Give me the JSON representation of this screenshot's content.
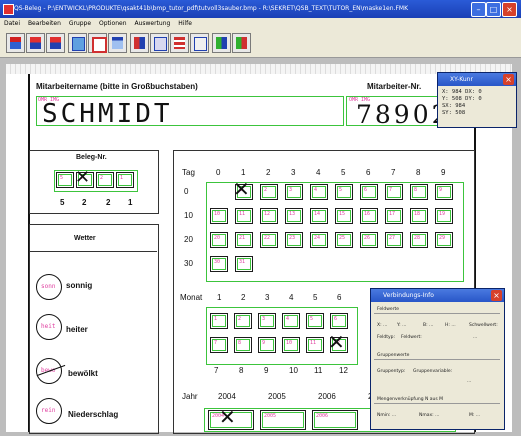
{
  "window": {
    "title": "QS-Beleg - P:\\ENTWICKL\\PRODUKTE\\qsakt41b\\bmp_tutor_pdf\\tutvoll3sauber.bmp - R:\\SEKRET\\QSB_TEXT\\TUTOR_EN\\maske1en.FMK"
  },
  "menu": [
    "Datei",
    "Bearbeiten",
    "Gruppe",
    "Optionen",
    "Auswertung",
    "Hilfe"
  ],
  "form": {
    "name_label": "Mitarbeitername (bitte in Großbuchstaben)",
    "nr_label": "Mitarbeiter-Nr.",
    "field_tag_1": "OMR IMG",
    "field_tag_2": "OMR IMG",
    "name_value": "SCHMIDT",
    "nr_value": "78902",
    "beleg_label": "Beleg-Nr.",
    "beleg_digits": [
      "5",
      "2",
      "2",
      "1"
    ],
    "beleg_cells": [
      "5",
      "2",
      "2",
      "1"
    ],
    "wetter_label": "Wetter",
    "weather": [
      {
        "tag": "sonn",
        "label": "sonnig"
      },
      {
        "tag": "heit",
        "label": "heiter"
      },
      {
        "tag": "bewo",
        "label": "bewölkt"
      },
      {
        "tag": "rein",
        "label": "Niederschlag"
      }
    ],
    "tag_label": "Tag",
    "tag_header": [
      "0",
      "1",
      "2",
      "3",
      "4",
      "5",
      "6",
      "7",
      "8",
      "9"
    ],
    "tag_rows": [
      {
        "label": "0",
        "cells": [
          "1",
          "2",
          "3",
          "4",
          "5",
          "6",
          "7",
          "8",
          "9"
        ]
      },
      {
        "label": "10",
        "cells": [
          "10",
          "11",
          "12",
          "13",
          "14",
          "15",
          "16",
          "17",
          "18",
          "19"
        ]
      },
      {
        "label": "20",
        "cells": [
          "20",
          "21",
          "22",
          "23",
          "24",
          "25",
          "26",
          "27",
          "28",
          "29"
        ]
      },
      {
        "label": "30",
        "cells": [
          "30",
          "31"
        ]
      }
    ],
    "monat_label": "Monat",
    "monat_header": [
      "1",
      "2",
      "3",
      "4",
      "5",
      "6"
    ],
    "monat_row1": [
      "1",
      "2",
      "3",
      "4",
      "5",
      "6"
    ],
    "monat_row2": [
      "7",
      "8",
      "9",
      "10",
      "11",
      "12"
    ],
    "monat_footer": [
      "7",
      "8",
      "9",
      "10",
      "11",
      "12"
    ],
    "jahr_label": "Jahr",
    "jahr_header": [
      "2004",
      "2005",
      "2006",
      "2"
    ],
    "jahr_cells": [
      "2004",
      "2005",
      "2006"
    ]
  },
  "xy_window": {
    "title": "XY-Kunr",
    "lines": [
      "X: 984   DX: 0",
      "Y: 508   DY: 0",
      "SX: 984",
      "SY: 508"
    ]
  },
  "info_window": {
    "title": "Verbindungs-Info",
    "feldwerte": "Feldwerte",
    "row1": [
      "X: ...",
      "Y: ...",
      "B: ...",
      "H: ...",
      "Schwellwert:"
    ],
    "row2": [
      "Feldtyp:",
      "Feldwert:",
      "..."
    ],
    "gruppenwerte": "Gruppenwerte",
    "row3": [
      "Gruppentyp:",
      "Gruppenvariable:"
    ],
    "row3b": "...",
    "mengen": "Mengenverknüpfung N aus M",
    "row4": [
      "Nmin: ...",
      "Nmax: ...",
      "M: ..."
    ]
  }
}
